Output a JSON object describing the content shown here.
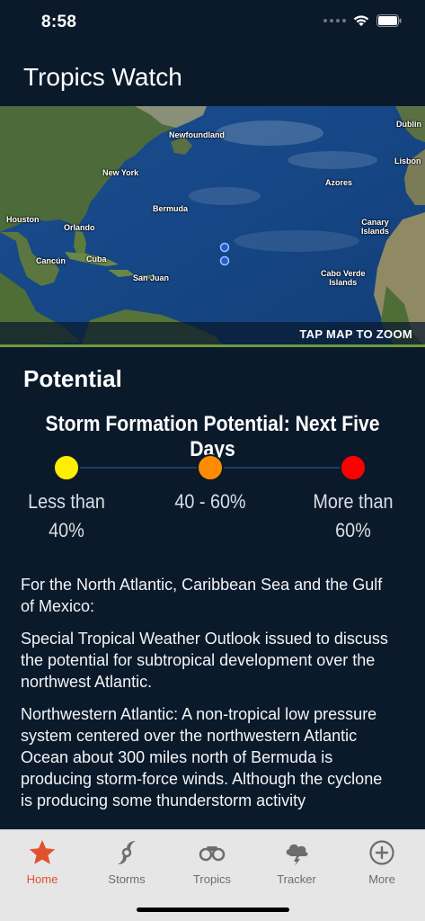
{
  "status": {
    "time": "8:58"
  },
  "app": {
    "title": "Tropics Watch"
  },
  "map": {
    "labels": {
      "newfoundland": "Newfoundland",
      "dublin": "Dublin",
      "new_york": "New York",
      "azores": "Azores",
      "lisbon": "Lisbon",
      "bermuda": "Bermuda",
      "houston": "Houston",
      "orlando": "Orlando",
      "canary": "Canary\nIslands",
      "cancun": "Cancún",
      "cuba": "Cuba",
      "san_juan": "San Juan",
      "cabo_verde": "Cabo Verde\nIslands"
    },
    "zoom_hint": "TAP MAP TO ZOOM"
  },
  "potential": {
    "section_title": "Potential",
    "chart_title": "Storm Formation Potential: Next Five Days",
    "levels": [
      {
        "label": "Less than\n40%",
        "color": "#ffee00"
      },
      {
        "label": "40 - 60%",
        "color": "#ff8c00"
      },
      {
        "label": "More than\n60%",
        "color": "#ff0000"
      }
    ]
  },
  "outlook": {
    "paragraphs": [
      "For the North Atlantic, Caribbean Sea and the Gulf of Mexico:",
      "Special Tropical Weather Outlook issued to dis­cuss the potential for subtropical development over the northwest Atlantic.",
      "Northwestern Atlantic: A non-tropical low pres­sure system centered over the northwestern Atlantic Ocean about 300 miles north of Bermu­da is producing storm-force winds. Although the cyclone is producing some thunderstorm activi­ty"
    ]
  },
  "tabs": [
    {
      "label": "Home",
      "icon": "star-icon",
      "active": true
    },
    {
      "label": "Storms",
      "icon": "hurricane-icon",
      "active": false
    },
    {
      "label": "Tropics",
      "icon": "binoculars-icon",
      "active": false
    },
    {
      "label": "Tracker",
      "icon": "storm-cloud-icon",
      "active": false
    },
    {
      "label": "More",
      "icon": "plus-circle-icon",
      "active": false
    }
  ],
  "colors": {
    "background": "#0b1a2b",
    "accent": "#e0522e",
    "tab_bar": "#e6e6e6"
  }
}
